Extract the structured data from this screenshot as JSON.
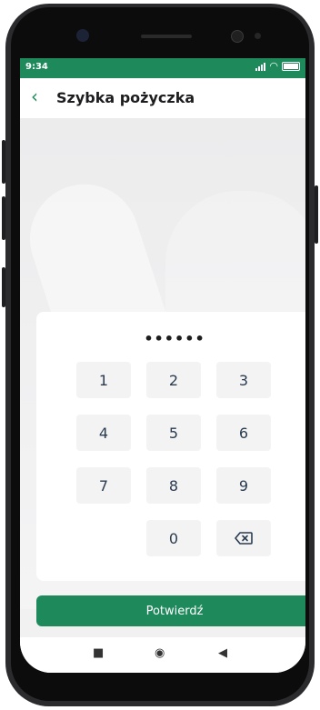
{
  "status_bar": {
    "time": "9:34",
    "battery": "100"
  },
  "app_bar": {
    "title": "Szybka pożyczka",
    "back_icon": "chevron-left-icon"
  },
  "pin": {
    "masked_value": "••••••"
  },
  "keypad": {
    "keys": [
      "1",
      "2",
      "3",
      "4",
      "5",
      "6",
      "7",
      "8",
      "9",
      "0"
    ],
    "delete_icon": "backspace-icon"
  },
  "confirm_button": {
    "label": "Potwierdź"
  },
  "nav": {
    "recent_icon": "square-icon",
    "home_icon": "circle-icon",
    "back_icon": "triangle-back-icon"
  },
  "colors": {
    "brand": "#1e8a5c",
    "key_bg": "#f3f3f4"
  }
}
